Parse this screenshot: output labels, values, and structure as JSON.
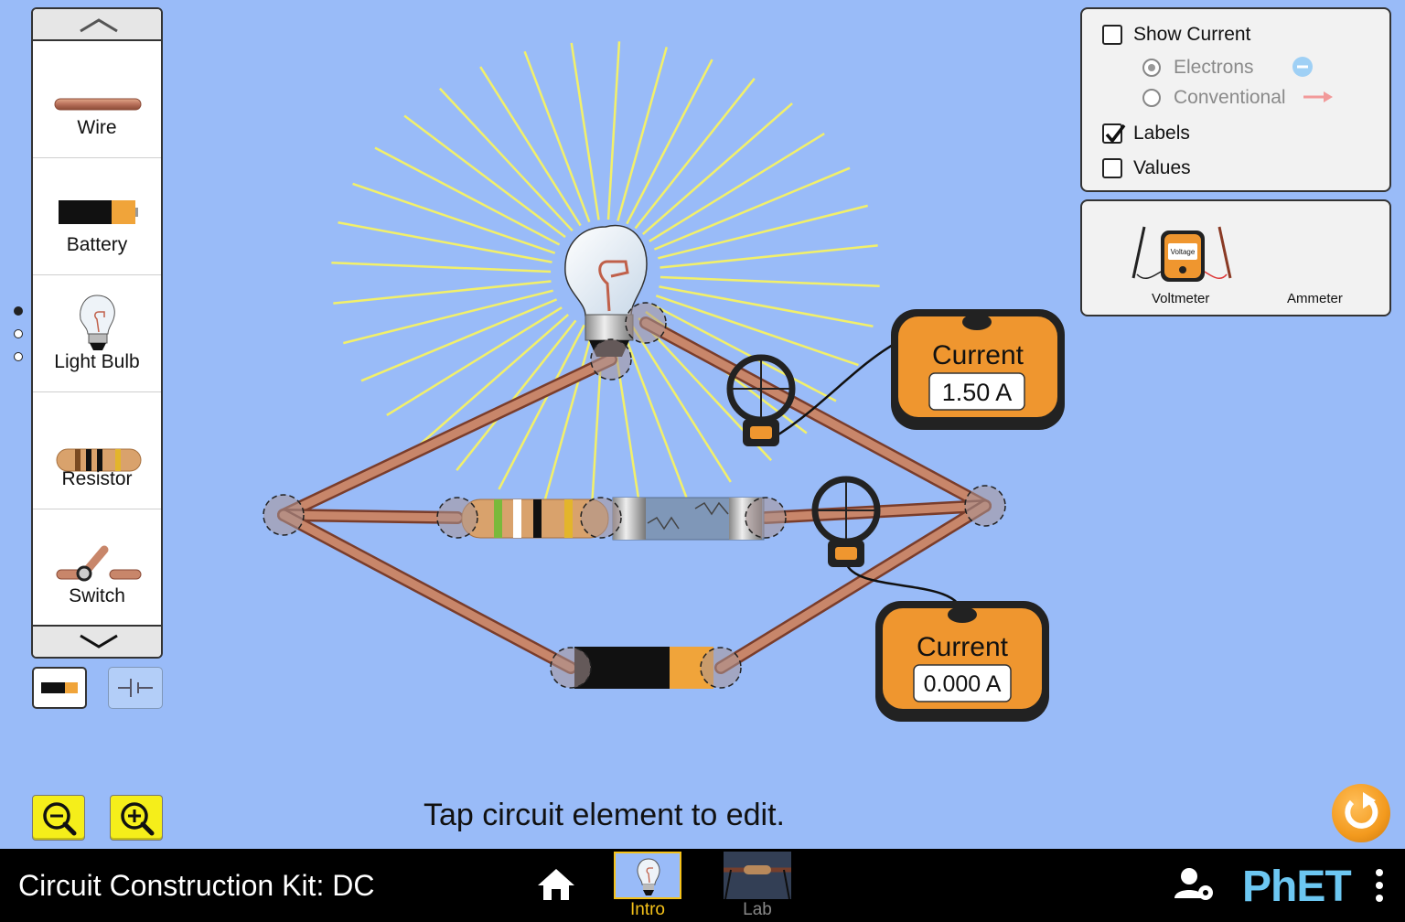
{
  "toolbox": {
    "items": [
      {
        "label": "Wire"
      },
      {
        "label": "Battery"
      },
      {
        "label": "Light Bulb"
      },
      {
        "label": "Resistor"
      },
      {
        "label": "Switch"
      }
    ]
  },
  "hint": "Tap circuit element to edit.",
  "current_panel": {
    "show_current_label": "Show Current",
    "show_current_checked": false,
    "electrons_label": "Electrons",
    "conventional_label": "Conventional",
    "selected_mode": "Electrons",
    "labels_label": "Labels",
    "labels_checked": true,
    "values_label": "Values",
    "values_checked": false
  },
  "tools_panel": {
    "voltmeter_label": "Voltmeter",
    "voltmeter_screen_text": "Voltage",
    "ammeter_label": "Ammeter"
  },
  "ammeters": [
    {
      "title": "Current",
      "reading": "1.50 A"
    },
    {
      "title": "Current",
      "reading": "0.000 A"
    }
  ],
  "navbar": {
    "title": "Circuit Construction Kit: DC",
    "screens": [
      {
        "label": "Intro",
        "selected": true
      },
      {
        "label": "Lab",
        "selected": false
      }
    ],
    "brand": "PhET"
  },
  "colors": {
    "background": "#99bbf8",
    "wire": "#c07a5a",
    "meter_body": "#ef962f",
    "light_rays": "#f2f06a",
    "selected_screen": "#f5c21a"
  }
}
